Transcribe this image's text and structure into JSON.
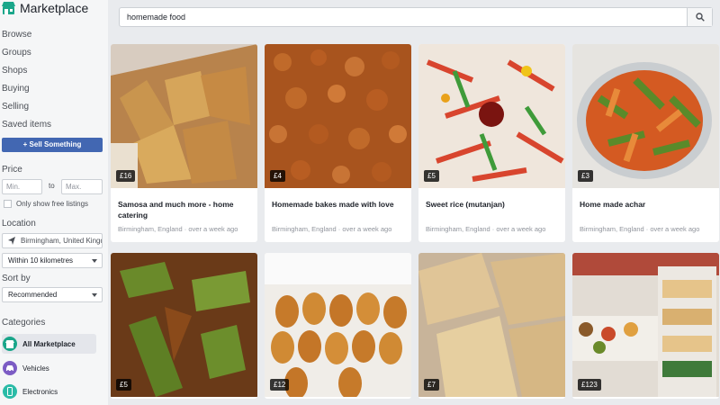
{
  "app": {
    "title": "Marketplace"
  },
  "sidebar": {
    "nav": [
      "Browse",
      "Groups",
      "Shops",
      "Buying",
      "Selling",
      "Saved items"
    ],
    "sell_button": "+ Sell Something",
    "price": {
      "label": "Price",
      "min_placeholder": "Min.",
      "to": "to",
      "max_placeholder": "Max.",
      "free_only": "Only show free listings"
    },
    "location": {
      "label": "Location",
      "value": "Birmingham, United Kingdom",
      "radius": "Within 10 kilometres"
    },
    "sort": {
      "label": "Sort by",
      "value": "Recommended"
    },
    "categories": {
      "label": "Categories",
      "items": [
        "All Marketplace",
        "Vehicles",
        "Electronics"
      ]
    }
  },
  "search": {
    "query": "homemade food",
    "icon": "search-icon"
  },
  "listings": [
    {
      "price": "£16",
      "title": "Samosa and much more - home catering",
      "location": "Birmingham, England · over a week ago"
    },
    {
      "price": "£4",
      "title": "Homemade bakes made with love",
      "location": "Birmingham, England · over a week ago"
    },
    {
      "price": "£5",
      "title": "Sweet rice (mutanjan)",
      "location": "Birmingham, England · over a week ago"
    },
    {
      "price": "£3",
      "title": "Home made achar",
      "location": "Birmingham, England · over a week ago"
    },
    {
      "price": "£5",
      "title": "",
      "location": ""
    },
    {
      "price": "£12",
      "title": "",
      "location": ""
    },
    {
      "price": "£7",
      "title": "",
      "location": ""
    },
    {
      "price": "£123",
      "title": "",
      "location": ""
    }
  ],
  "colors": {
    "accent": "#4267b2",
    "brand_icon": "#1aa68a"
  }
}
